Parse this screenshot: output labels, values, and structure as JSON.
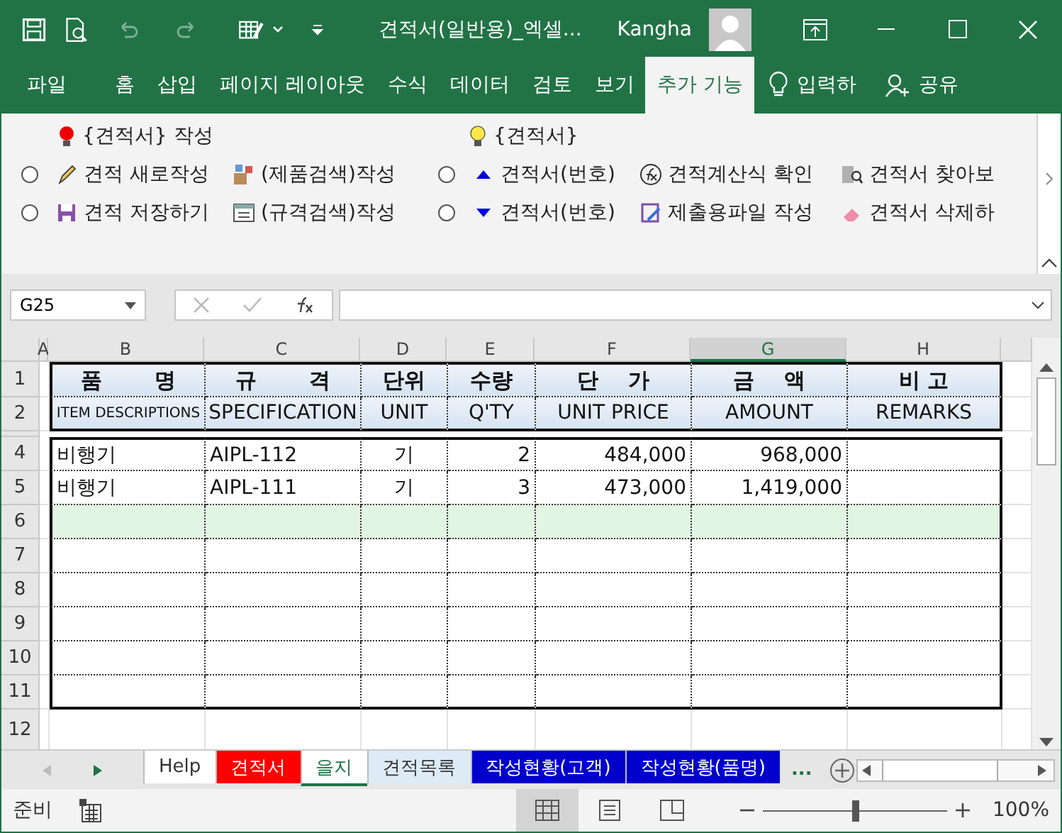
{
  "window": {
    "title": "견적서(일반용)_엑셀...",
    "user": "Kangha"
  },
  "menu_tabs": [
    {
      "label": "파일",
      "selected": false
    },
    {
      "label": "홈",
      "selected": false
    },
    {
      "label": "삽입",
      "selected": false
    },
    {
      "label": "페이지 레이아웃",
      "selected": false
    },
    {
      "label": "수식",
      "selected": false
    },
    {
      "label": "데이터",
      "selected": false
    },
    {
      "label": "검토",
      "selected": false
    },
    {
      "label": "보기",
      "selected": false
    },
    {
      "label": "추가 기능",
      "selected": true
    }
  ],
  "tell_me": "입력하",
  "share": "공유",
  "ribbon": {
    "headings": [
      {
        "label": "{견적서} 작성",
        "kind": "red"
      },
      {
        "label": "{견적서}",
        "kind": "yellow"
      }
    ],
    "rows": [
      {
        "radios": [
          {
            "checked": false
          },
          {
            "checked": false
          }
        ],
        "items": [
          {
            "kind": "pencil",
            "label": "견적 새로작성"
          },
          {
            "kind": "boxes",
            "label": "(제품검색)작성"
          },
          {
            "kind": "up",
            "label": "견적서(번호)"
          },
          {
            "kind": "fx",
            "label": "견적계산식 확인"
          },
          {
            "kind": "find",
            "label": "견적서 찾아보"
          }
        ]
      },
      {
        "radios": [
          {
            "checked": false
          },
          {
            "checked": false
          }
        ],
        "items": [
          {
            "kind": "save",
            "label": "견적 저장하기"
          },
          {
            "kind": "form",
            "label": "(규격검색)작성"
          },
          {
            "kind": "down",
            "label": "견적서(번호)"
          },
          {
            "kind": "export",
            "label": "제출용파일 작성"
          },
          {
            "kind": "eraser",
            "label": "견적서 삭제하"
          }
        ]
      }
    ]
  },
  "formula_bar": {
    "name_box": "G25"
  },
  "columns": [
    {
      "label": "A",
      "selected": false
    },
    {
      "label": "B",
      "selected": false
    },
    {
      "label": "C",
      "selected": false
    },
    {
      "label": "D",
      "selected": false
    },
    {
      "label": "E",
      "selected": false
    },
    {
      "label": "F",
      "selected": false
    },
    {
      "label": "G",
      "selected": true
    },
    {
      "label": "H",
      "selected": false
    }
  ],
  "rows": [
    {
      "label": "1",
      "kind": "header",
      "highlighted": false,
      "cells": [
        "품       명",
        "규       격",
        "단위",
        "수량",
        "단    가",
        "금    액",
        "비 고"
      ]
    },
    {
      "label": "2",
      "kind": "header",
      "highlighted": false,
      "cells": [
        "ITEM DESCRIPTIONS",
        "SPECIFICATION",
        "UNIT",
        "Q'TY",
        "UNIT PRICE",
        "AMOUNT",
        "REMARKS"
      ]
    },
    {
      "label": "4",
      "kind": "item",
      "highlighted": false,
      "name": "비행기",
      "spec": "AIPL-112",
      "unit": "기",
      "qty": "2",
      "unit_price": "484,000",
      "amount": "968,000"
    },
    {
      "label": "5",
      "kind": "item",
      "highlighted": false,
      "name": "비행기",
      "spec": "AIPL-111",
      "unit": "기",
      "qty": "3",
      "unit_price": "473,000",
      "amount": "1,419,000"
    },
    {
      "label": "6",
      "kind": "item",
      "highlighted": true
    },
    {
      "label": "7",
      "kind": "item",
      "highlighted": false
    },
    {
      "label": "8",
      "kind": "item",
      "highlighted": false
    },
    {
      "label": "9",
      "kind": "item",
      "highlighted": false
    },
    {
      "label": "10",
      "kind": "item",
      "highlighted": false
    },
    {
      "label": "11",
      "kind": "item",
      "highlighted": false
    },
    {
      "label": "12",
      "kind": "outside",
      "highlighted": false
    }
  ],
  "sheet_tabs": [
    {
      "label": "Help",
      "selected": false,
      "color": "#ffffff"
    },
    {
      "label": "견적서",
      "selected": false,
      "color": "#ff0000"
    },
    {
      "label": "을지",
      "selected": true,
      "color": "#ffffff"
    },
    {
      "label": "견적목록",
      "selected": false,
      "color": "#ddebf7"
    },
    {
      "label": "작성현황(고객)",
      "selected": false,
      "color": "#0000cc"
    },
    {
      "label": "작성현황(품명)",
      "selected": false,
      "color": "#0000cc"
    }
  ],
  "more_tabs": "...",
  "status_bar": {
    "status": "준비",
    "views": [
      {
        "kind": "normal",
        "selected": true
      },
      {
        "kind": "layout",
        "selected": false
      },
      {
        "kind": "break",
        "selected": false
      }
    ],
    "zoom": {
      "level": 0.5,
      "reading": "100%"
    }
  }
}
